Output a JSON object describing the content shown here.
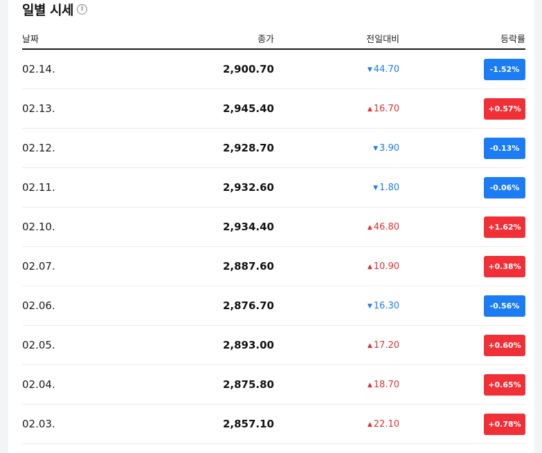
{
  "header": {
    "title": "일별 시세",
    "info_icon": "info-circle-icon"
  },
  "columns": {
    "date": "날짜",
    "close": "종가",
    "diff": "전일대비",
    "rate": "등락률"
  },
  "colors": {
    "up": "#f03036",
    "down": "#1b7cf3"
  },
  "rows": [
    {
      "date": "02.14.",
      "close": "2,900.70",
      "direction": "down",
      "arrow": "▼",
      "diff": "44.70",
      "rate": "-1.52%"
    },
    {
      "date": "02.13.",
      "close": "2,945.40",
      "direction": "up",
      "arrow": "▲",
      "diff": "16.70",
      "rate": "+0.57%"
    },
    {
      "date": "02.12.",
      "close": "2,928.70",
      "direction": "down",
      "arrow": "▼",
      "diff": "3.90",
      "rate": "-0.13%"
    },
    {
      "date": "02.11.",
      "close": "2,932.60",
      "direction": "down",
      "arrow": "▼",
      "diff": "1.80",
      "rate": "-0.06%"
    },
    {
      "date": "02.10.",
      "close": "2,934.40",
      "direction": "up",
      "arrow": "▲",
      "diff": "46.80",
      "rate": "+1.62%"
    },
    {
      "date": "02.07.",
      "close": "2,887.60",
      "direction": "up",
      "arrow": "▲",
      "diff": "10.90",
      "rate": "+0.38%"
    },
    {
      "date": "02.06.",
      "close": "2,876.70",
      "direction": "down",
      "arrow": "▼",
      "diff": "16.30",
      "rate": "-0.56%"
    },
    {
      "date": "02.05.",
      "close": "2,893.00",
      "direction": "up",
      "arrow": "▲",
      "diff": "17.20",
      "rate": "+0.60%"
    },
    {
      "date": "02.04.",
      "close": "2,875.80",
      "direction": "up",
      "arrow": "▲",
      "diff": "18.70",
      "rate": "+0.65%"
    },
    {
      "date": "02.03.",
      "close": "2,857.10",
      "direction": "up",
      "arrow": "▲",
      "diff": "22.10",
      "rate": "+0.78%"
    }
  ]
}
